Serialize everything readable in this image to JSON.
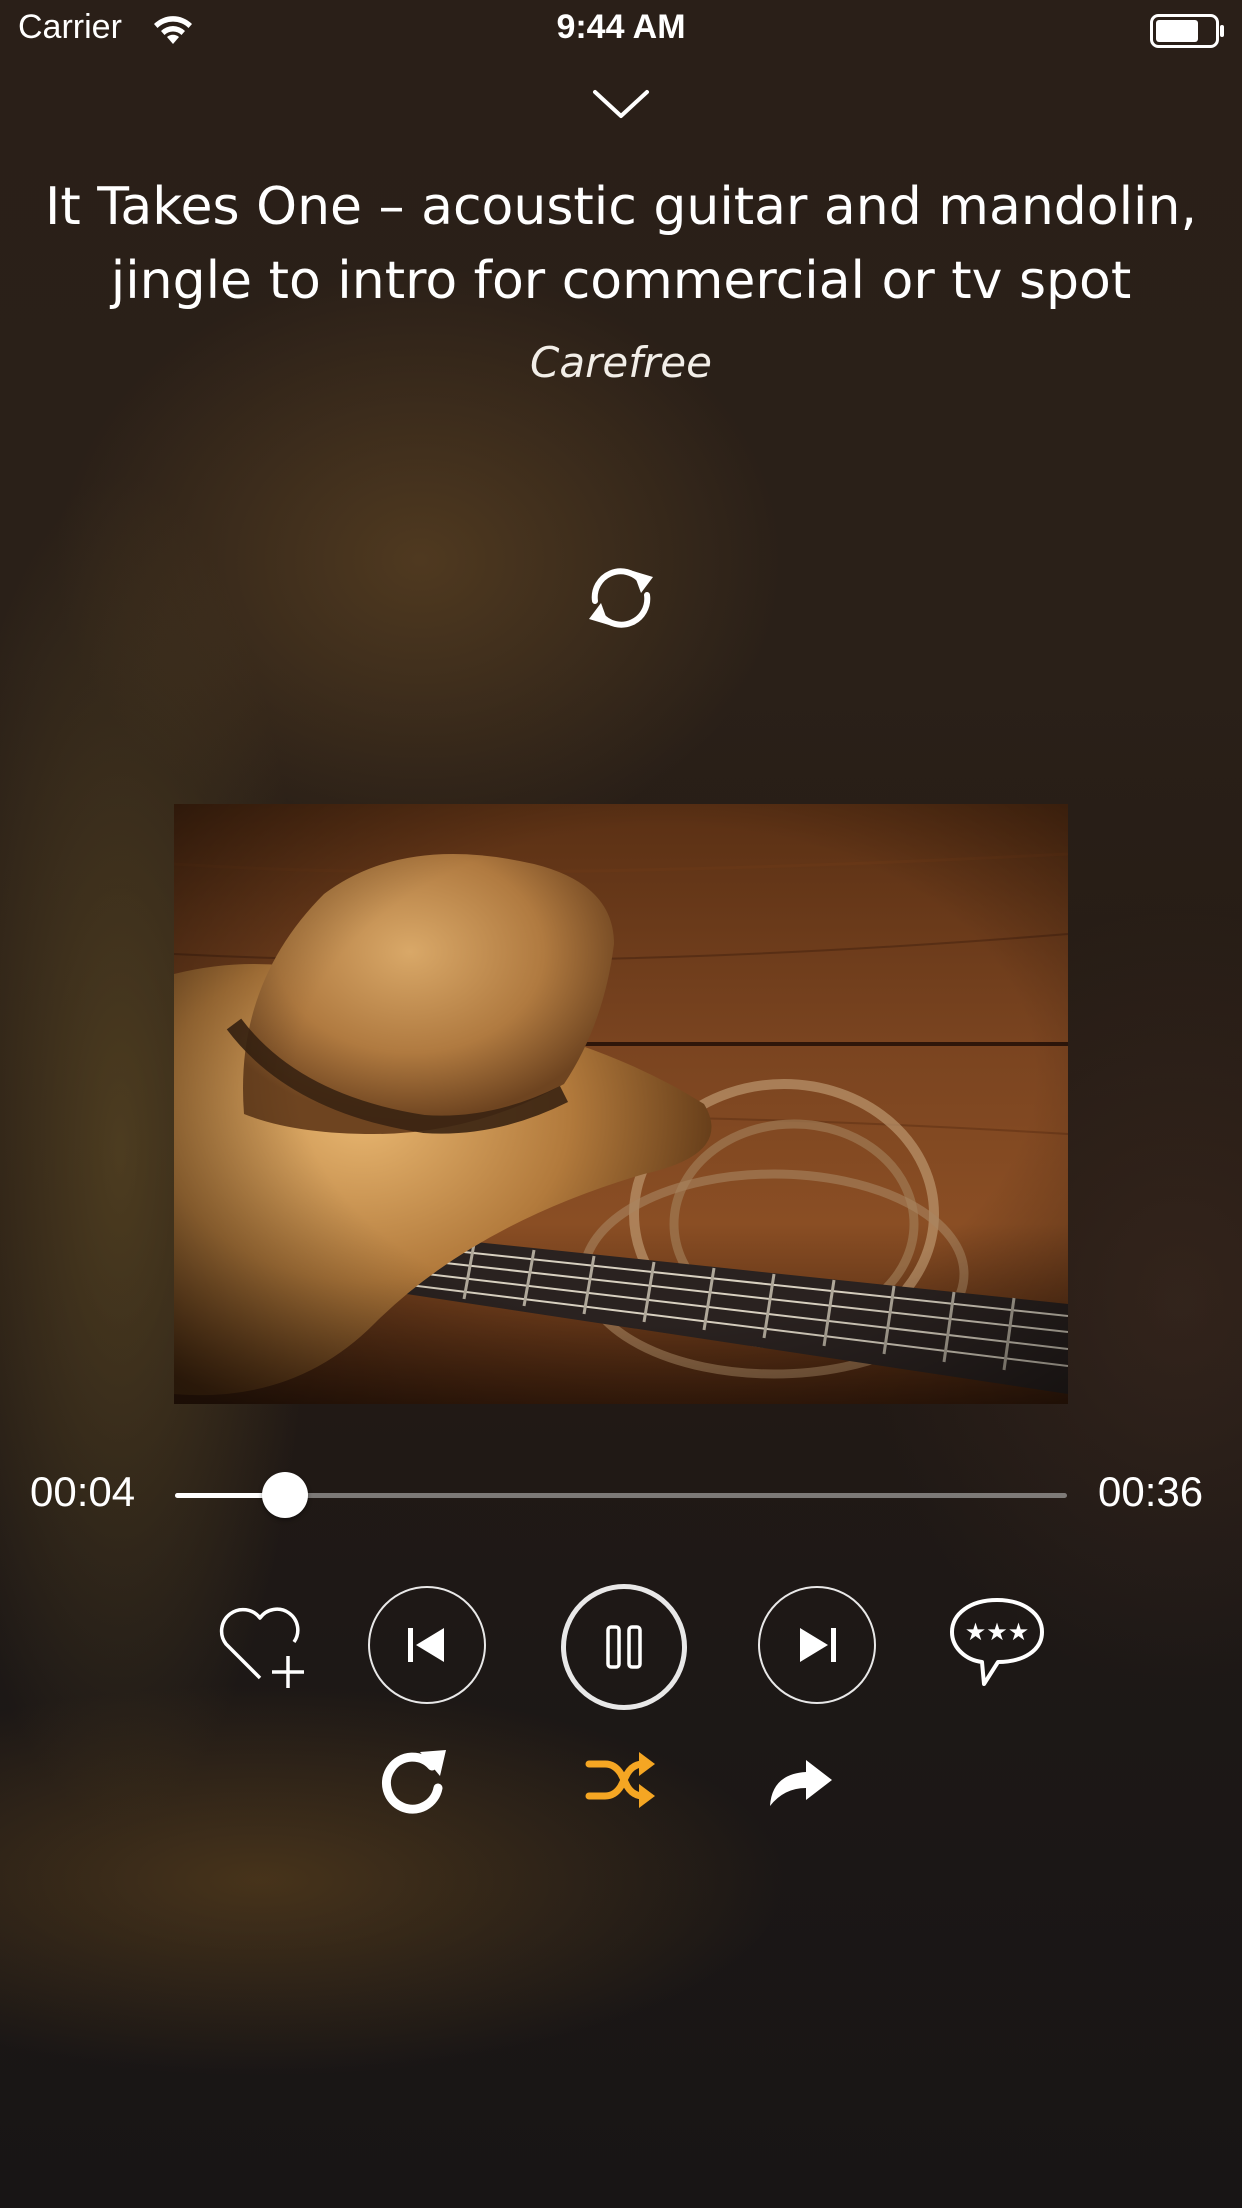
{
  "status_bar": {
    "carrier": "Carrier",
    "time": "9:44 AM",
    "wifi_icon": "wifi-icon",
    "battery_icon": "battery-icon"
  },
  "header": {
    "collapse_icon": "chevron-down-icon"
  },
  "track": {
    "title": "It Takes One – acoustic guitar and mandolin, jingle to intro for commercial or tv spot",
    "subtitle": "Carefree",
    "artwork_icon": "album-artwork"
  },
  "sync_icon": "sync-icon",
  "playback": {
    "elapsed": "00:04",
    "total": "00:36",
    "progress_fraction": 0.123
  },
  "controls": {
    "favorite_icon": "heart-add-icon",
    "previous_icon": "skip-previous-icon",
    "pause_icon": "pause-icon",
    "next_icon": "skip-next-icon",
    "comment_icon": "rating-comment-icon",
    "repeat_icon": "repeat-icon",
    "shuffle_icon": "shuffle-icon",
    "share_icon": "share-icon"
  },
  "colors": {
    "accent_shuffle": "#f5a623",
    "text": "#ffffff"
  }
}
